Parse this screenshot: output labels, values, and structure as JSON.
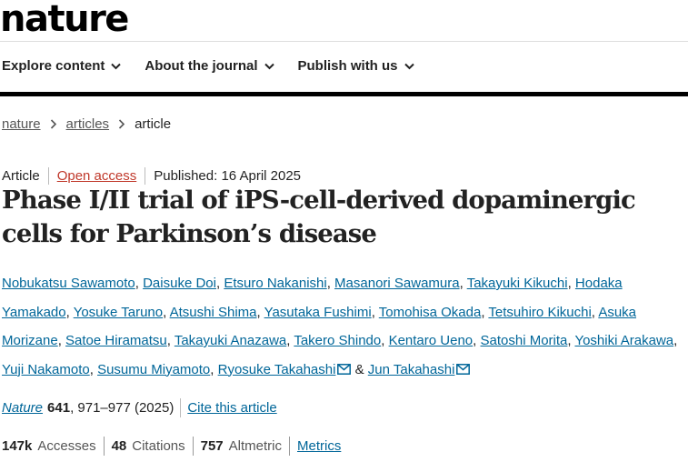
{
  "logo": "nature",
  "nav": {
    "items": [
      {
        "label": "Explore content"
      },
      {
        "label": "About the journal"
      },
      {
        "label": "Publish with us"
      }
    ]
  },
  "breadcrumb": {
    "items": [
      "nature",
      "articles"
    ],
    "current": "article"
  },
  "article": {
    "type": "Article",
    "access": "Open access",
    "published": "Published: 16 April 2025",
    "title": "Phase I/II trial of iPS-cell-derived dopaminergic cells for Parkinson’s disease",
    "authors": [
      "Nobukatsu Sawamoto",
      "Daisuke Doi",
      "Etsuro Nakanishi",
      "Masanori Sawamura",
      "Takayuki Kikuchi",
      "Hodaka Yamakado",
      "Yosuke Taruno",
      "Atsushi Shima",
      "Yasutaka Fushimi",
      "Tomohisa Okada",
      "Tetsuhiro Kikuchi",
      "Asuka Morizane",
      "Satoe Hiramatsu",
      "Takayuki Anazawa",
      "Takero Shindo",
      "Kentaro Ueno",
      "Satoshi Morita",
      "Yoshiki Arakawa",
      "Yuji Nakamoto",
      "Susumu Miyamoto",
      "Ryosuke Takahashi",
      "Jun Takahashi"
    ],
    "corresponding": [
      "Ryosuke Takahashi",
      "Jun Takahashi"
    ],
    "journal": "Nature",
    "volume": "641",
    "pages_year": ", 971–977 (2025)",
    "cite_label": "Cite this article"
  },
  "metrics": {
    "accesses_value": "147k",
    "accesses_label": "Accesses",
    "citations_value": "48",
    "citations_label": "Citations",
    "altmetric_value": "757",
    "altmetric_label": "Altmetric",
    "metrics_link": "Metrics"
  }
}
